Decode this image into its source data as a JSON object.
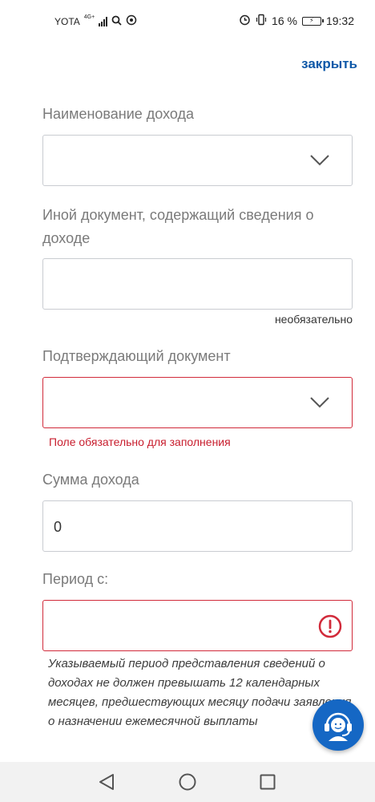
{
  "status_bar": {
    "carrier": "YOTA",
    "network": "4G+",
    "battery": "16 %",
    "time": "19:32"
  },
  "header": {
    "close_label": "закрыть"
  },
  "form": {
    "income_name": {
      "label": "Наименование дохода",
      "value": ""
    },
    "other_document": {
      "label": "Иной документ, содержащий сведения о доходе",
      "value": "",
      "optional": "необязательно"
    },
    "confirming_document": {
      "label": "Подтверждающий документ",
      "value": "",
      "error": "Поле обязательно для заполнения"
    },
    "income_amount": {
      "label": "Сумма дохода",
      "value": "0"
    },
    "period_from": {
      "label": "Период с:",
      "value": ""
    },
    "hint": "Указываемый период представления сведений о доходах не должен превышать 12 календарных месяцев, предшествующих месяцу подачи заявления о назначении ежемесячной выплаты"
  },
  "colors": {
    "accent": "#0d58a8",
    "error": "#d12a3a",
    "support": "#1567c4"
  },
  "icons": [
    "search-icon",
    "alarm-icon",
    "vibrate-icon",
    "chevron-down-icon",
    "alert-circle-icon",
    "support-operator-icon",
    "back-icon",
    "home-icon",
    "recents-icon"
  ]
}
